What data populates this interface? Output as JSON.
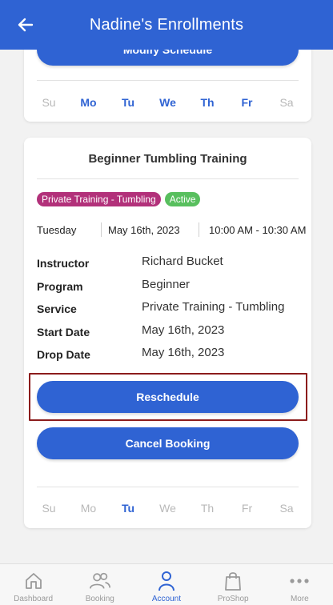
{
  "header": {
    "title": "Nadine's Enrollments"
  },
  "enrollments": [
    {
      "button_primary": "Modify Schedule",
      "days": [
        {
          "label": "Su",
          "active": false
        },
        {
          "label": "Mo",
          "active": true
        },
        {
          "label": "Tu",
          "active": true
        },
        {
          "label": "We",
          "active": true
        },
        {
          "label": "Th",
          "active": true
        },
        {
          "label": "Fr",
          "active": true
        },
        {
          "label": "Sa",
          "active": false
        }
      ]
    },
    {
      "title": "Beginner Tumbling Training",
      "category_badge": "Private Training - Tumbling",
      "status_badge": "Active",
      "weekday": "Tuesday",
      "date": "May 16th, 2023",
      "time": "10:00 AM - 10:30 AM",
      "details": [
        {
          "label": "Instructor",
          "value": "Richard Bucket"
        },
        {
          "label": "Program",
          "value": "Beginner"
        },
        {
          "label": "Service",
          "value": "Private Training - Tumbling"
        },
        {
          "label": "Start Date",
          "value": "May 16th, 2023"
        },
        {
          "label": "Drop Date",
          "value": "May 16th, 2023"
        }
      ],
      "reschedule_label": "Reschedule",
      "cancel_label": "Cancel Booking",
      "days": [
        {
          "label": "Su",
          "active": false
        },
        {
          "label": "Mo",
          "active": false
        },
        {
          "label": "Tu",
          "active": true
        },
        {
          "label": "We",
          "active": false
        },
        {
          "label": "Th",
          "active": false
        },
        {
          "label": "Fr",
          "active": false
        },
        {
          "label": "Sa",
          "active": false
        }
      ]
    }
  ],
  "nav": [
    {
      "label": "Dashboard",
      "icon": "home-icon",
      "active": false
    },
    {
      "label": "Booking",
      "icon": "users-icon",
      "active": false
    },
    {
      "label": "Account",
      "icon": "user-icon",
      "active": true
    },
    {
      "label": "ProShop",
      "icon": "shopping-bag-icon",
      "active": false
    },
    {
      "label": "More",
      "icon": "more-dots-icon",
      "active": false
    }
  ],
  "colors": {
    "primary": "#2f63d3",
    "category_badge": "#b2317a",
    "status_badge": "#58bf5e",
    "highlight_border": "#8c1c1c"
  }
}
